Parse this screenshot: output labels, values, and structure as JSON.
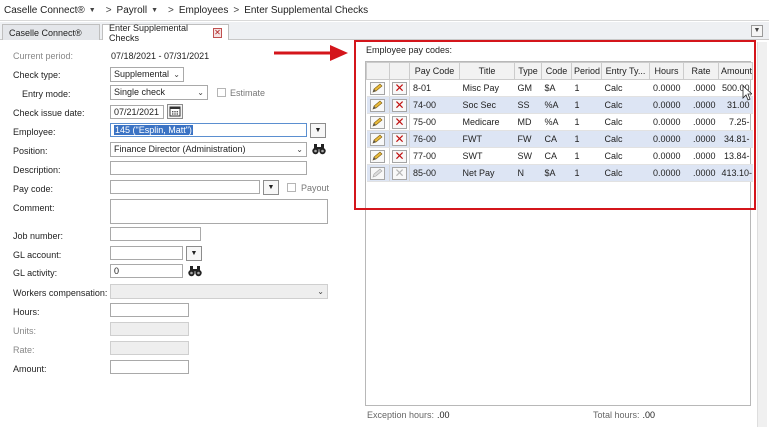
{
  "breadcrumb": {
    "items": [
      "Caselle Connect®",
      "Payroll",
      "Employees",
      "Enter Supplemental Checks"
    ]
  },
  "tabs": [
    {
      "label": "Caselle Connect®"
    },
    {
      "label": "Enter Supplemental Checks"
    }
  ],
  "form": {
    "current_period_label": "Current period:",
    "current_period_value": "07/18/2021 - 07/31/2021",
    "check_type_label": "Check type:",
    "check_type_value": "Supplemental",
    "entry_mode_label": "Entry mode:",
    "entry_mode_value": "Single check",
    "estimate_label": "Estimate",
    "check_issue_date_label": "Check issue date:",
    "check_issue_date_value": "07/21/2021",
    "employee_label": "Employee:",
    "employee_value": "145 (\"Esplin, Matt\")",
    "position_label": "Position:",
    "position_value": "Finance Director (Administration)",
    "description_label": "Description:",
    "pay_code_label": "Pay code:",
    "payout_label": "Payout",
    "comment_label": "Comment:",
    "job_number_label": "Job number:",
    "gl_account_label": "GL account:",
    "gl_activity_label": "GL activity:",
    "gl_activity_value": "0",
    "workers_comp_label": "Workers compensation:",
    "hours_label": "Hours:",
    "units_label": "Units:",
    "rate_label": "Rate:",
    "amount_label": "Amount:"
  },
  "grid": {
    "title": "Employee pay codes:",
    "columns": [
      "Pay Code",
      "Title",
      "Type",
      "Code",
      "Period",
      "Entry Ty...",
      "Hours",
      "Rate",
      "Amount"
    ],
    "rows": [
      {
        "pay_code": "8-01",
        "title": "Misc Pay",
        "type": "GM",
        "code": "$A",
        "period": "1",
        "entry": "Calc",
        "hours": "0.0000",
        "rate": ".0000",
        "amount": "500.00",
        "editable": true
      },
      {
        "pay_code": "74-00",
        "title": "Soc Sec",
        "type": "SS",
        "code": "%A",
        "period": "1",
        "entry": "Calc",
        "hours": "0.0000",
        "rate": ".0000",
        "amount": "31.00",
        "editable": true
      },
      {
        "pay_code": "75-00",
        "title": "Medicare",
        "type": "MD",
        "code": "%A",
        "period": "1",
        "entry": "Calc",
        "hours": "0.0000",
        "rate": ".0000",
        "amount": "7.25-",
        "editable": true
      },
      {
        "pay_code": "76-00",
        "title": "FWT",
        "type": "FW",
        "code": "CA",
        "period": "1",
        "entry": "Calc",
        "hours": "0.0000",
        "rate": ".0000",
        "amount": "34.81-",
        "editable": true
      },
      {
        "pay_code": "77-00",
        "title": "SWT",
        "type": "SW",
        "code": "CA",
        "period": "1",
        "entry": "Calc",
        "hours": "0.0000",
        "rate": ".0000",
        "amount": "13.84-",
        "editable": true
      },
      {
        "pay_code": "85-00",
        "title": "Net Pay",
        "type": "N",
        "code": "$A",
        "period": "1",
        "entry": "Calc",
        "hours": "0.0000",
        "rate": ".0000",
        "amount": "413.10-",
        "editable": false
      }
    ]
  },
  "footer": {
    "exception_hours_label": "Exception hours:",
    "exception_hours_value": ".00",
    "total_hours_label": "Total hours:",
    "total_hours_value": ".00"
  },
  "colors": {
    "highlight": "#d4151b",
    "row_alt": "#dde5f4",
    "selection": "#3b73c4"
  }
}
